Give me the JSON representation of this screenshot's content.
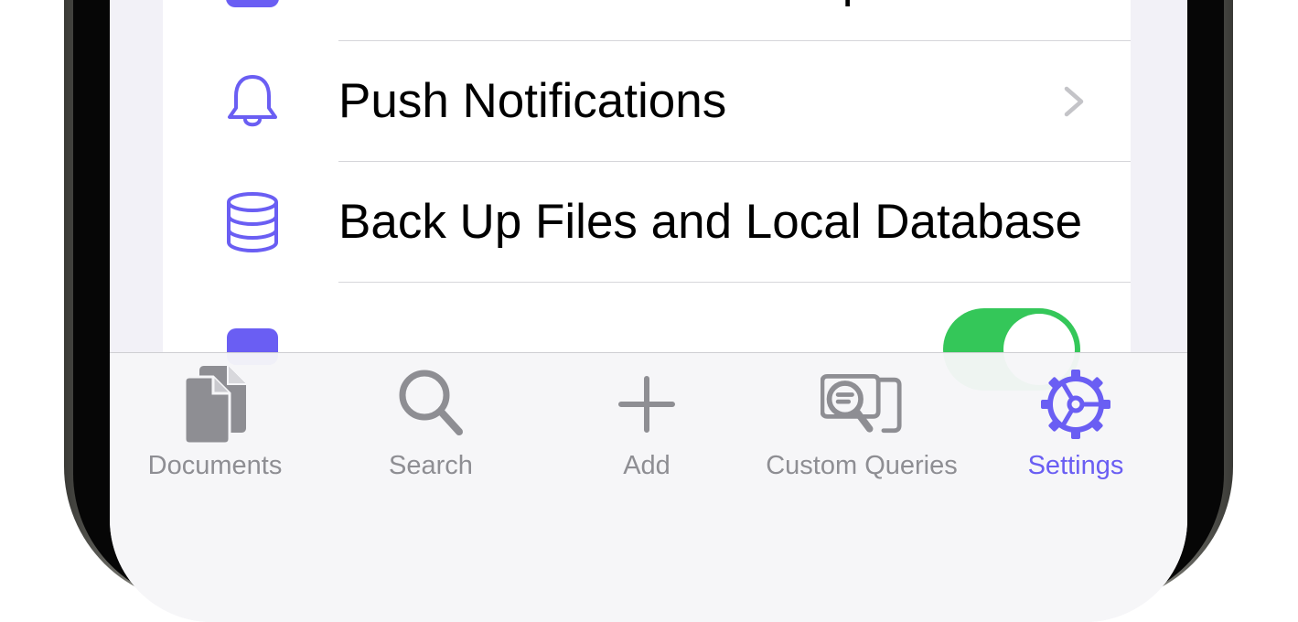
{
  "settings_rows": [
    {
      "label": "Default Filename for Imports",
      "icon": "download-icon",
      "has_chevron": true
    },
    {
      "label": "Push Notifications",
      "icon": "bell-icon",
      "has_chevron": true
    },
    {
      "label": "Back Up Files and Local Database",
      "icon": "database-icon",
      "has_chevron": false
    },
    {
      "label": "",
      "icon": "partial-icon",
      "toggle_on": true
    }
  ],
  "tabs": [
    {
      "label": "Documents",
      "icon": "documents-icon",
      "active": false
    },
    {
      "label": "Search",
      "icon": "search-icon",
      "active": false
    },
    {
      "label": "Add",
      "icon": "plus-icon",
      "active": false
    },
    {
      "label": "Custom Queries",
      "icon": "custom-queries-icon",
      "active": false
    },
    {
      "label": "Settings",
      "icon": "settings-icon",
      "active": true
    }
  ],
  "colors": {
    "accent": "#6a5ef3",
    "toggle_on": "#34c759",
    "tab_inactive": "#8e8e93"
  }
}
